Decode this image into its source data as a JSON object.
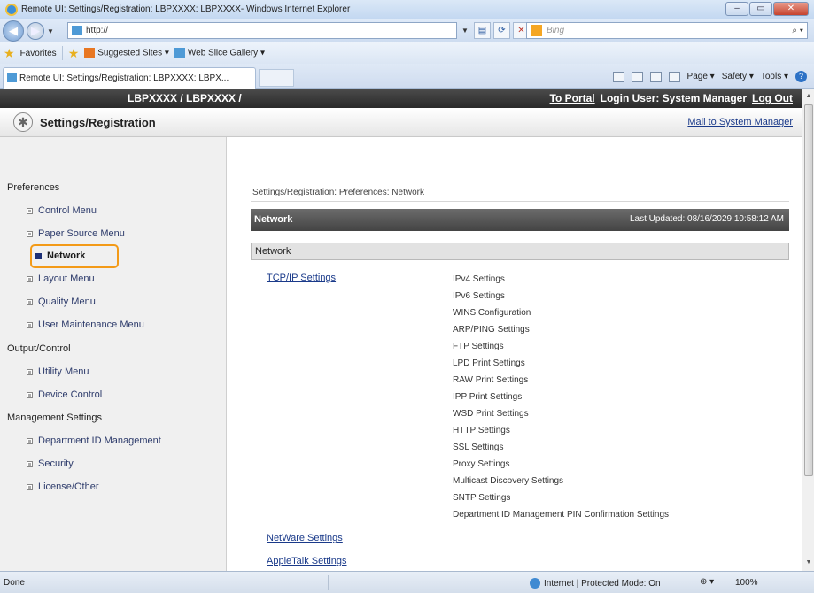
{
  "window": {
    "title": "Remote UI: Settings/Registration: LBPXXXX: LBPXXXX- Windows Internet Explorer",
    "minimize": "–",
    "maximize": "▭",
    "close": "✕"
  },
  "address_bar": {
    "url": "http://",
    "search_placeholder": "Bing"
  },
  "favorites_bar": {
    "favorites": "Favorites",
    "suggested": "Suggested Sites ▾",
    "web_slice": "Web Slice Gallery ▾"
  },
  "tab": {
    "label": "Remote UI: Settings/Registration: LBPXXXX: LBPX..."
  },
  "command_bar": {
    "page": "Page ▾",
    "safety": "Safety ▾",
    "tools": "Tools ▾"
  },
  "header": {
    "model": "LBPXXXX / LBPXXXX /",
    "to_portal": "To Portal",
    "login_user": "Login User: System Manager",
    "logout": "Log Out",
    "page_title": "Settings/Registration",
    "mail": "Mail to System Manager"
  },
  "sidebar": {
    "preferences": "Preferences",
    "control_menu": "Control Menu",
    "paper_source_menu": "Paper Source Menu",
    "network": "Network",
    "layout_menu": "Layout Menu",
    "quality_menu": "Quality Menu",
    "user_maintenance_menu": "User Maintenance Menu",
    "output_control": "Output/Control",
    "utility_menu": "Utility Menu",
    "device_control": "Device Control",
    "management_settings": "Management Settings",
    "department_id": "Department ID Management",
    "security": "Security",
    "license_other": "License/Other"
  },
  "main": {
    "breadcrumb": "Settings/Registration: Preferences: Network",
    "header_title": "Network",
    "last_updated": "Last Updated: 08/16/2029 10:58:12 AM",
    "section_title": "Network",
    "tcpip": "TCP/IP Settings",
    "tcpip_items": [
      "IPv4 Settings",
      "IPv6 Settings",
      "WINS Configuration",
      "ARP/PING Settings",
      "FTP Settings",
      "LPD Print Settings",
      "RAW Print Settings",
      "IPP Print Settings",
      "WSD Print Settings",
      "HTTP Settings",
      "SSL Settings",
      "Proxy Settings",
      "Multicast Discovery Settings",
      "SNTP Settings",
      "Department ID Management PIN Confirmation Settings"
    ],
    "netware": "NetWare Settings",
    "appletalk": "AppleTalk Settings"
  },
  "status_bar": {
    "done": "Done",
    "zone": "Internet | Protected Mode: On",
    "zoom": "100%"
  }
}
